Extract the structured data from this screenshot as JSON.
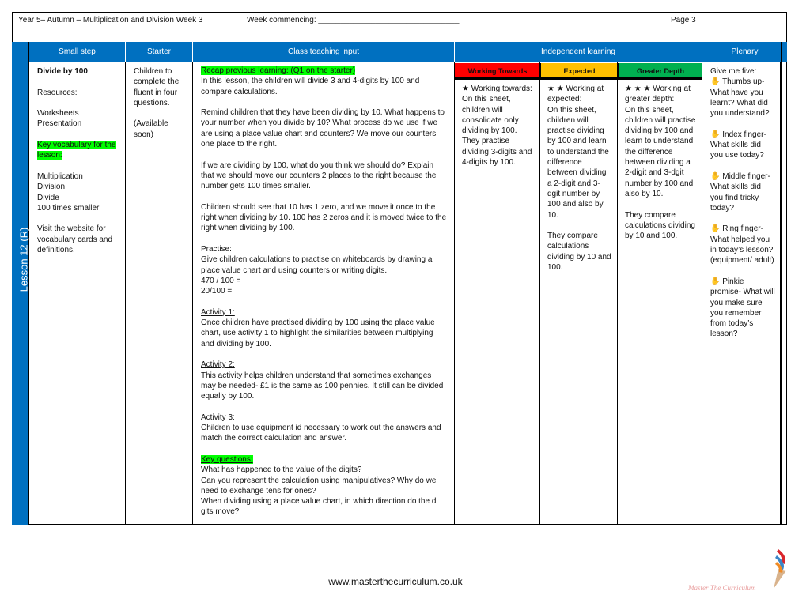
{
  "header": {
    "title": "Year 5– Autumn – Multiplication and Division Week 3",
    "week": "Week commencing: ________________________________",
    "page": "Page 3"
  },
  "lesson_label": "Lesson 12 (R)",
  "columns": [
    "Small step",
    "Starter",
    "Class teaching input",
    "Independent learning",
    "Plenary"
  ],
  "small_step": {
    "title": "Divide by 100",
    "resources_label": "Resources:",
    "resources": [
      "Worksheets",
      "Presentation"
    ],
    "vocab_label": "Key vocabulary for the lesson:",
    "vocab": [
      "Multiplication",
      "Division",
      "Divide",
      "100 times smaller"
    ],
    "visit": "Visit the website for vocabulary cards and definitions."
  },
  "starter": {
    "text": "Children to complete the fluent in four questions.",
    "note": "(Available soon)"
  },
  "teaching": {
    "recap": "Recap previous learning: (Q1 on the starter)",
    "intro": "In this lesson, the children will divide 3 and 4-digits by 100 and compare calculations.",
    "p1": "Remind children that they have been dividing by 10. What happens to your number when you divide by 10? What process do we use if we are using a place value chart and counters? We move our counters one place to the right.",
    "p2": "If we are dividing by 100, what do you think we should do? Explain that we should move our counters 2 places to the right because the number gets 100 times smaller.",
    "p3": "Children should see that 10 has 1 zero, and we move it once to the right when dividing by 10. 100 has 2 zeros and it is moved twice to the right when dividing by 100.",
    "practise_label": "Practise:",
    "practise": "Give children calculations to practise on whiteboards by drawing a place value chart and using counters or writing digits.",
    "calc1": "470 / 100 =",
    "calc2": "20/100 =",
    "a1_label": "Activity 1:",
    "a1": "Once children have practised dividing by 100 using the place value chart, use activity 1 to highlight the similarities between multiplying and dividing by 100.",
    "a2_label": "Activity 2:",
    "a2": "This activity helps children understand that sometimes exchanges may be needed- £1 is the same as 100 pennies. It still can be divided equally by 100.",
    "a3_label": "Activity 3:",
    "a3": "Children to use equipment id necessary to work out the answers and match the correct calculation and answer.",
    "kq_label": "Key questions:",
    "kq": [
      "What has happened to the value of the digits?",
      "Can you represent the calculation using manipulatives? Why do we need to exchange tens for ones?",
      "When dividing using a place value chart, in which direction do the di gits move?"
    ]
  },
  "independent": [
    {
      "label": "Working Towards",
      "color": "#FF0000",
      "stars": "★",
      "text": "Working towards:",
      "body": "On this sheet, children will consolidate only dividing by 100. They practise dividing 3-digits and 4-digits by 100.",
      "body2": ""
    },
    {
      "label": "Expected",
      "color": "#FFC000",
      "stars": "★ ★",
      "text": "Working at expected:",
      "body": "On this sheet, children will practise dividing by 100 and learn to understand the difference between dividing a 2-digit and 3-dgit number by 100 and also by 10.",
      "body2": "They compare calculations dividing by 10 and 100."
    },
    {
      "label": "Greater Depth",
      "color": "#00B050",
      "stars": "★ ★ ★",
      "text": "Working at greater depth:",
      "body": "On this sheet, children will practise dividing by 100 and learn to understand the difference between dividing a 2-digit and 3-dgit number by 100 and also by 10.",
      "body2": "They compare calculations dividing by 10 and 100."
    }
  ],
  "plenary": {
    "intro": "Give me five:",
    "items": [
      "Thumbs up- What have you learnt? What did you understand?",
      "Index finger- What skills did you use today?",
      "Middle finger- What skills did you find tricky today?",
      "Ring finger- What helped you in today’s lesson? (equipment/ adult)",
      "Pinkie promise- What will you make sure you remember from today’s lesson?"
    ]
  },
  "footer": {
    "url": "www.masterthecurriculum.co.uk",
    "logo_text": "Master The Curriculum"
  }
}
